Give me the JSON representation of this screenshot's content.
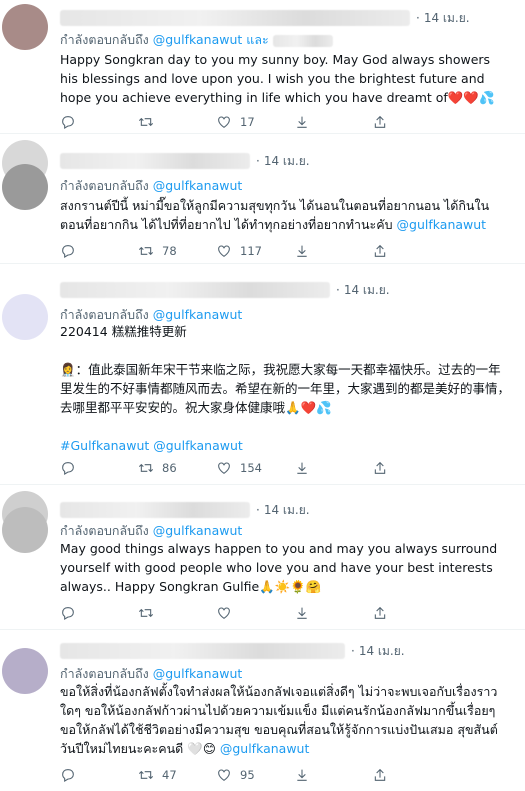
{
  "tweets": [
    {
      "time": "14 เม.ย.",
      "reply_prefix": "กำลังตอบกลับถึง",
      "reply_handle": "@gulfkanawut",
      "reply_suffix": "และ",
      "body": "Happy Songkran day to you my sunny boy. May God always showers his blessings and love upon you. I wish you the brightest future and hope you achieve everything in life which you have dreamt of",
      "emoji": "❤️❤️💦",
      "retweets": "",
      "likes": "17"
    },
    {
      "time": "14 เม.ย.",
      "reply_prefix": "กำลังตอบกลับถึง",
      "reply_handle": "@gulfkanawut",
      "body": "สงกรานต์ปีนี้ หม่ามี๊ขอให้ลูกมีความสุขทุกวัน ได้นอนในตอนที่อยากนอน ได้กินในตอนที่อยากกิน ได้ไปที่ที่อยากไป ได้ทำทุกอย่างที่อยากทำนะคับ",
      "body_handle": "@gulfkanawut",
      "retweets": "78",
      "likes": "117"
    },
    {
      "time": "14 เม.ย.",
      "reply_prefix": "กำลังตอบกลับถึง",
      "reply_handle": "@gulfkanawut",
      "line1": "220414 糕糕推特更新",
      "para": "👩‍⚕️：值此泰国新年宋干节来临之际，我祝愿大家每一天都幸福快乐。过去的一年里发生的不好事情都随风而去。希望在新的一年里，大家遇到的都是美好的事情，去哪里都平平安安的。祝大家身体健康哦🙏❤️💦",
      "hashtags": "#Gulfkanawut @gulfkanawut",
      "retweets": "86",
      "likes": "154"
    },
    {
      "time": "14 เม.ย.",
      "reply_prefix": "กำลังตอบกลับถึง",
      "reply_handle": "@gulfkanawut",
      "body": "May good things always happen to you and may you always surround yourself with good people who love you and have your best interests always.. Happy Songkran Gulfie🙏☀️🌻🤗",
      "retweets": "",
      "likes": ""
    },
    {
      "time": "14 เม.ย.",
      "reply_prefix": "กำลังตอบกลับถึง",
      "reply_handle": "@gulfkanawut",
      "body": "ขอให้สิ่งที่น้องกลัฟตั้งใจทำส่งผลให้น้องกลัฟเจอแต่สิ่งดีๆ ไม่ว่าจะพบเจอกับเรื่องราวใดๆ ขอให้น้องกลัฟก้าวผ่านไปด้วยความเข้มแข็ง มีแต่คนรักน้องกลัฟมากขึ้นเรื่อยๆ ขอให้กลัฟได้ใช้ชีวิตอย่างมีความสุข ขอบคุณที่สอนให้รู้จักการแบ่งปันเสมอ สุขสันต์วันปีใหม่ไทยนะคะคนดี 🤍😊",
      "body_handle": "@gulfkanawut",
      "retweets": "47",
      "likes": "95"
    }
  ],
  "colors": {
    "text": "#0f1419",
    "muted": "#536471",
    "link": "#1d9bf0",
    "divider": "#eff3f4"
  },
  "icons": [
    "reply-icon",
    "retweet-icon",
    "like-icon",
    "download-icon",
    "share-icon"
  ]
}
